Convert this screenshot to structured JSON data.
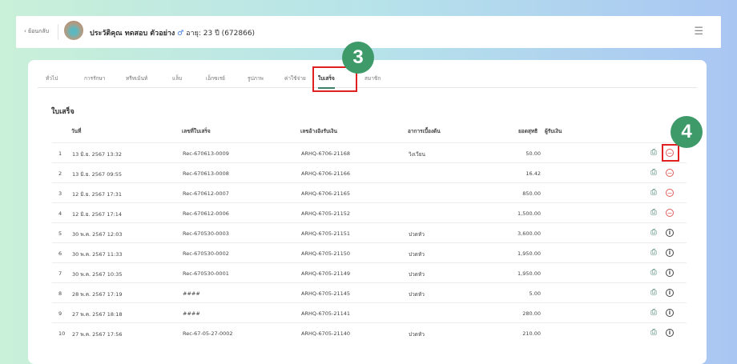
{
  "header": {
    "back_label": "ย้อนกลับ",
    "patient_title": "ประวัติคุณ ทดสอบ ตัวอย่าง",
    "gender_icon": "♂",
    "age": "อายุ: 23 ปี (672866)"
  },
  "tabs": [
    "ทั่วไป",
    "การรักษา",
    "ทรีทเม้นท์",
    "แล็บ",
    "เอ็กซเรย์",
    "รูปภาพ",
    "ค่าใช้จ่าย",
    "ใบเสร็จ",
    "สมาชิก"
  ],
  "active_tab": "ใบเสร็จ",
  "section_title": "ใบเสร็จ",
  "columns": [
    "วันที่",
    "เลขที่ใบเสร็จ",
    "เลขอ้างอิงรับเงิน",
    "อาการเบื้องต้น",
    "ยอดสุทธิ",
    "ผู้รับเงิน"
  ],
  "rows": [
    {
      "no": "1",
      "date": "13 มิ.ย. 2567 13:32",
      "receipt": "Rec-670613-0009",
      "ref": "ARHQ-6706-21168",
      "symptom": "วิงเวียน",
      "amount": "50.00",
      "action": "cancel"
    },
    {
      "no": "2",
      "date": "13 มิ.ย. 2567 09:55",
      "receipt": "Rec-670613-0008",
      "ref": "ARHQ-6706-21166",
      "symptom": "",
      "amount": "16.42",
      "action": "cancel"
    },
    {
      "no": "3",
      "date": "12 มิ.ย. 2567 17:31",
      "receipt": "Rec-670612-0007",
      "ref": "ARHQ-6706-21165",
      "symptom": "",
      "amount": "850.00",
      "action": "cancel"
    },
    {
      "no": "4",
      "date": "12 มิ.ย. 2567 17:14",
      "receipt": "Rec-670612-0006",
      "ref": "ARHQ-6705-21152",
      "symptom": "",
      "amount": "1,500.00",
      "action": "cancel"
    },
    {
      "no": "5",
      "date": "30 พ.ค. 2567 12:03",
      "receipt": "Rec-670530-0003",
      "ref": "ARHQ-6705-21151",
      "symptom": "ปวดหัว",
      "amount": "3,600.00",
      "action": "info"
    },
    {
      "no": "6",
      "date": "30 พ.ค. 2567 11:33",
      "receipt": "Rec-670530-0002",
      "ref": "ARHQ-6705-21150",
      "symptom": "ปวดหัว",
      "amount": "1,950.00",
      "action": "info"
    },
    {
      "no": "7",
      "date": "30 พ.ค. 2567 10:35",
      "receipt": "Rec-670530-0001",
      "ref": "ARHQ-6705-21149",
      "symptom": "ปวดหัว",
      "amount": "1,950.00",
      "action": "info"
    },
    {
      "no": "8",
      "date": "28 พ.ค. 2567 17:19",
      "receipt": "####",
      "ref": "ARHQ-6705-21145",
      "symptom": "ปวดหัว",
      "amount": "5.00",
      "action": "info"
    },
    {
      "no": "9",
      "date": "27 พ.ค. 2567 18:18",
      "receipt": "####",
      "ref": "ARHQ-6705-21141",
      "symptom": "",
      "amount": "280.00",
      "action": "info"
    },
    {
      "no": "10",
      "date": "27 พ.ค. 2567 17:56",
      "receipt": "Rec-67-05-27-0002",
      "ref": "ARHQ-6705-21140",
      "symptom": "ปวดหัว",
      "amount": "210.00",
      "action": "info"
    }
  ],
  "annotations": {
    "step3": "3",
    "step4": "4"
  },
  "colors": {
    "accent": "#3e7f6c",
    "badge": "#3f9a6a",
    "cancel": "#e25b5b",
    "highlight": "#e02020"
  }
}
